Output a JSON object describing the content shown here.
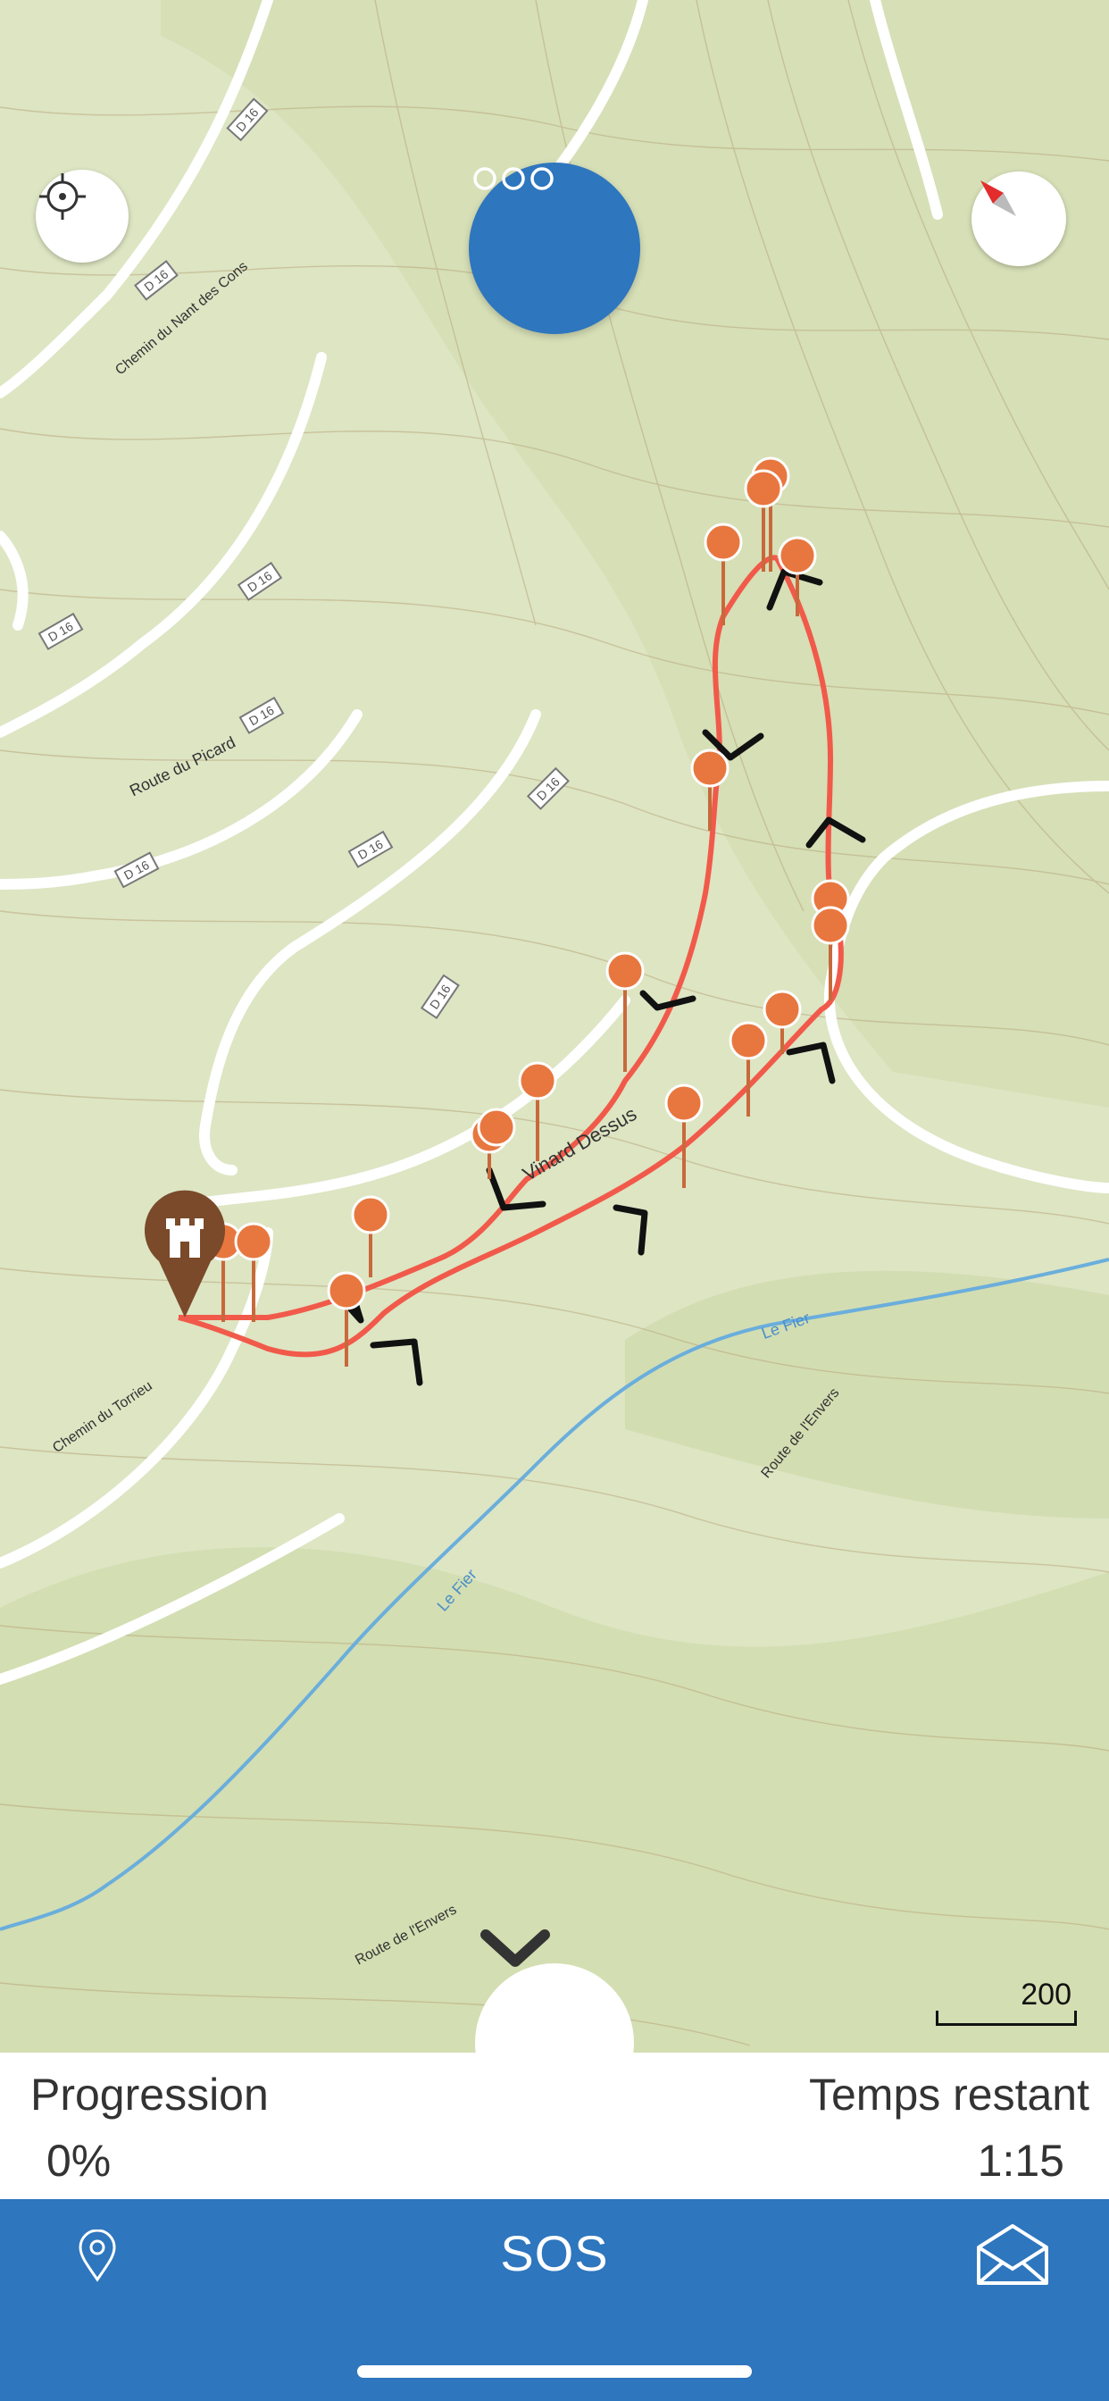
{
  "map": {
    "road_labels": [
      "D 16",
      "D 16",
      "D 16",
      "D 16",
      "D 16",
      "D 16",
      "D 16",
      "D 16",
      "D 16"
    ],
    "street_labels": [
      "Route du Picard",
      "Chemin du Nant des Cons",
      "Chemin du Torrieu",
      "Vinard Dessus",
      "Route de l'Envers",
      "Route de l'Envers",
      "Le Fier",
      "Le Fier"
    ],
    "scale_label": "200",
    "icons": {
      "locate": "crosshair-icon",
      "compass": "compass-icon",
      "menu": "more-icon",
      "collapse": "chevron-down-icon",
      "start": "castle-marker-icon",
      "waypoint": "swap-arrows-icon"
    },
    "colors": {
      "route": "#f15a4a",
      "waypoint": "#e8773f",
      "accent": "#2e76be",
      "start_marker": "#7a4a2a"
    }
  },
  "stats": {
    "progress_label": "Progression",
    "progress_value": "0%",
    "remaining_label": "Temps restant",
    "remaining_value": "1:15"
  },
  "tabbar": {
    "sos_label": "SOS",
    "left_icon": "location-pin-icon",
    "right_icon": "envelope-icon"
  }
}
